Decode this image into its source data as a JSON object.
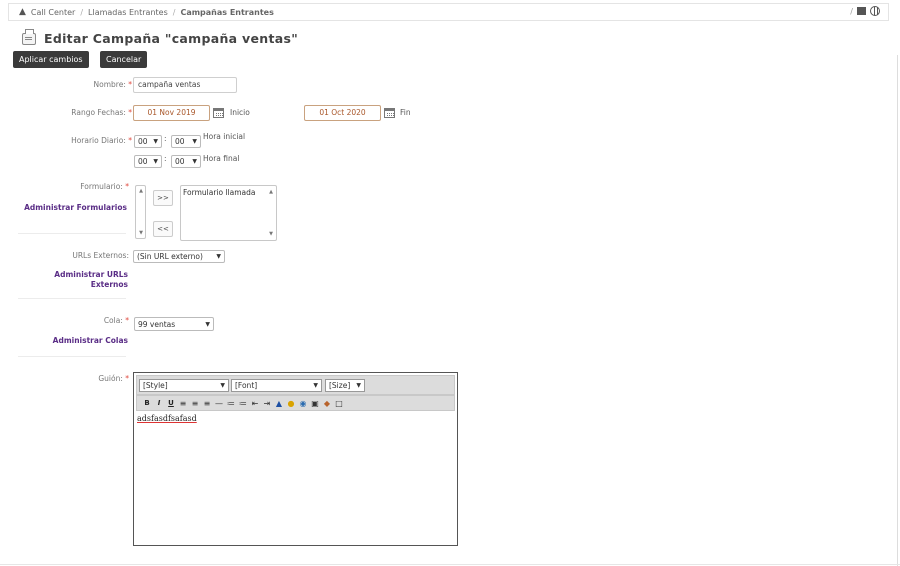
{
  "breadcrumb": {
    "items": [
      "Call Center",
      "Llamadas Entrantes"
    ],
    "current": "Campañas Entrantes",
    "right_sep": "/"
  },
  "page": {
    "title": "Editar Campaña \"campaña ventas\"",
    "apply_label": "Aplicar cambios",
    "cancel_label": "Cancelar"
  },
  "form": {
    "nombre": {
      "label": "Nombre:",
      "value": "campaña ventas"
    },
    "rango": {
      "label": "Rango Fechas:",
      "start": "01 Nov 2019",
      "start_label": "Inicio",
      "end": "01 Oct 2020",
      "end_label": "Fin"
    },
    "horario": {
      "label": "Horario Diario:",
      "start_h": "00",
      "start_m": "00",
      "start_label": "Hora inicial",
      "end_h": "00",
      "end_m": "00",
      "end_label": "Hora final",
      "colon": ":"
    },
    "formulario": {
      "label": "Formulario:",
      "admin_link": "Administrar Formularios",
      "available": [],
      "selected": [
        "Formulario llamada"
      ],
      "add_label": ">>",
      "remove_label": "<<"
    },
    "urls": {
      "label": "URLs Externos:",
      "value": "(Sin URL externo)",
      "admin_link_1": "Administrar URLs",
      "admin_link_2": "Externos"
    },
    "cola": {
      "label": "Cola:",
      "value": "99 ventas",
      "admin_link": "Administrar Colas"
    },
    "guion": {
      "label": "Guión:",
      "style": "[Style]",
      "font": "[Font]",
      "size": "[Size]",
      "content": "adsfasdfsafasd"
    },
    "required_mark": "*"
  },
  "colors": {
    "button_bg": "#3a3a3a",
    "link": "#5a2d86",
    "required": "#e0473c",
    "date_text": "#a9572a"
  }
}
